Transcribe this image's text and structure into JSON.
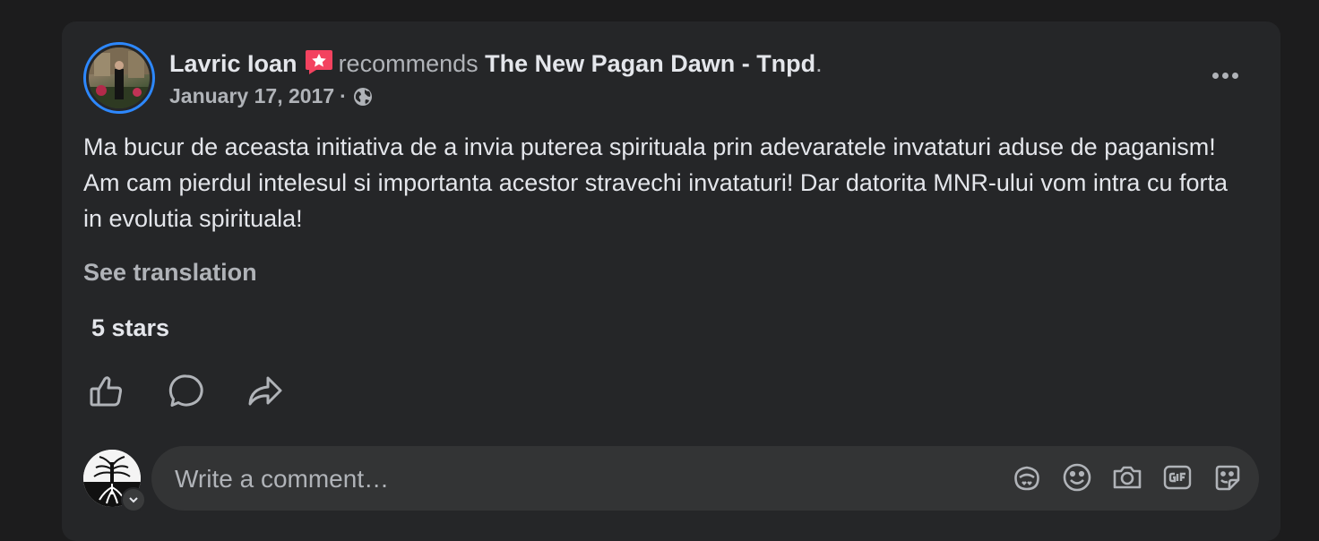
{
  "post": {
    "author": "Lavric Ioan",
    "action": "recommends",
    "page_name": "The New Pagan Dawn - Tnpd",
    "page_suffix": ".",
    "date": "January 17, 2017",
    "date_sep": "·",
    "body": "Ma bucur de aceasta initiativa de a invia puterea spirituala prin adevaratele invataturi aduse de paganism! Am cam pierdul intelesul si importanta acestor stravechi invataturi! Dar datorita MNR-ului vom intra cu forta in evolutia spirituala!",
    "see_translation": "See translation",
    "rating": "5 stars"
  },
  "composer": {
    "placeholder": "Write a comment…"
  },
  "icons": [
    "recommend-icon",
    "globe-icon",
    "more-icon",
    "like-icon",
    "comment-icon",
    "share-icon",
    "avatar-icon",
    "sticker-icon",
    "emoji-icon",
    "camera-icon",
    "gif-icon",
    "chevron-down-icon"
  ],
  "colors": {
    "card_bg": "#252628",
    "accent_ring": "#2d88ff",
    "recommend_badge": "#f3425f",
    "secondary_text": "#b0b3b8"
  }
}
